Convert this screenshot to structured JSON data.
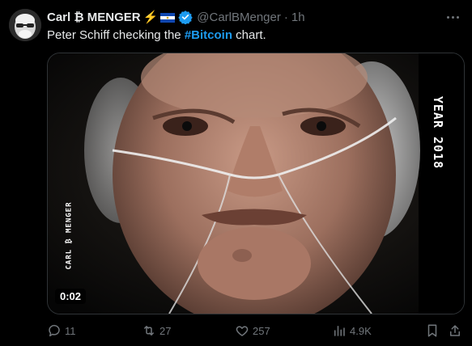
{
  "author": {
    "display_name": "Carl ₿ MENGER",
    "emoji_bolt": "⚡",
    "flag": "el-salvador-flag",
    "verified": true,
    "handle": "@CarlBMenger",
    "separator": "·",
    "time": "1h"
  },
  "tweet": {
    "text_before": "Peter Schiff checking the ",
    "hashtag": "#Bitcoin",
    "text_after": " chart."
  },
  "media": {
    "watermark_left": "CARL ₿ MENGER",
    "watermark_right": "YEAR 2018",
    "duration": "0:02"
  },
  "actions": {
    "replies": "11",
    "reposts": "27",
    "likes": "257",
    "views": "4.9K"
  },
  "colors": {
    "background": "#000000",
    "text": "#e7e9ea",
    "muted": "#71767b",
    "link": "#1d9bf0",
    "verified": "#1d9bf0"
  }
}
